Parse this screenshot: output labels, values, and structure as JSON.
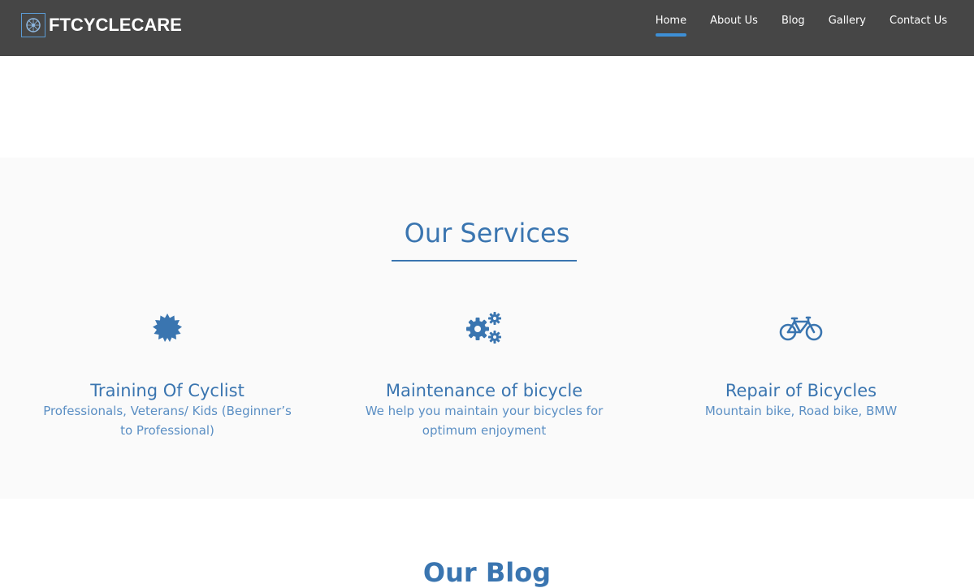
{
  "header": {
    "brand": "FTCYCLECARE",
    "logo_icon": "bicycle-wheel-icon",
    "nav": [
      {
        "label": "Home",
        "active": true
      },
      {
        "label": "About Us",
        "active": false
      },
      {
        "label": "Blog",
        "active": false
      },
      {
        "label": "Gallery",
        "active": false
      },
      {
        "label": "Contact Us",
        "active": false
      }
    ],
    "colors": {
      "bar": "#464646",
      "accent": "#3d8fd6"
    }
  },
  "services": {
    "title": "Our Services",
    "items": [
      {
        "icon": "certificate-badge-icon",
        "title": "Training Of Cyclist",
        "description": "Professionals, Veterans/ Kids (Beginner’s to Professional)"
      },
      {
        "icon": "cogs-icon",
        "title": "Maintenance of bicycle",
        "description": "We help you maintain your bicycles for optimum enjoyment"
      },
      {
        "icon": "bicycle-icon",
        "title": "Repair of Bicycles",
        "description": "Mountain bike, Road bike, BMW"
      }
    ],
    "colors": {
      "primary": "#3a75b0",
      "text": "#5b8fc4",
      "background": "#fafafa"
    }
  },
  "blog": {
    "title": "Our Blog"
  }
}
